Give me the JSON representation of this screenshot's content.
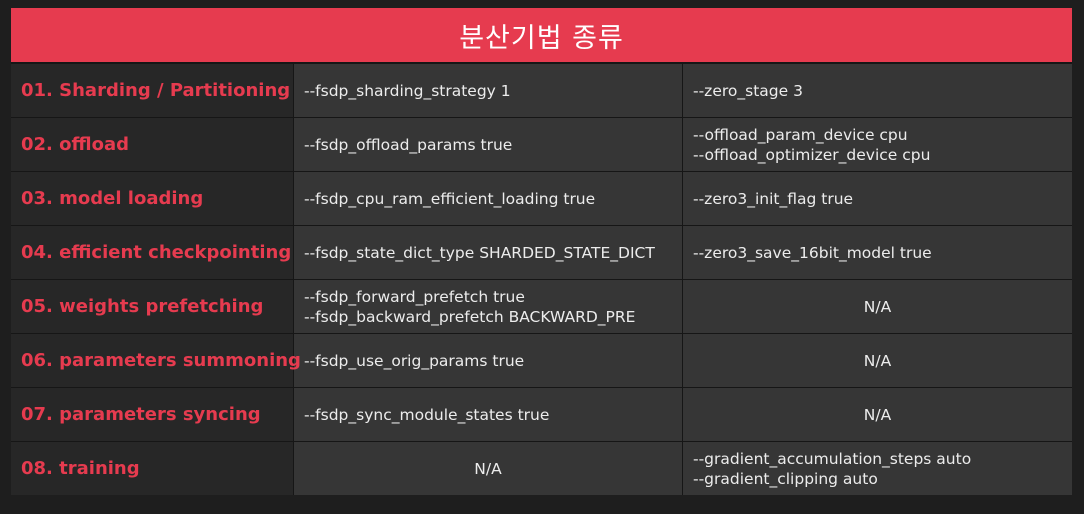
{
  "title": "분산기법 종류",
  "rows": [
    {
      "category": "01. Sharding / Partitioning",
      "fsdp": [
        "--fsdp_sharding_strategy 1"
      ],
      "deepspeed": [
        "--zero_stage 3"
      ]
    },
    {
      "category": "02. offload",
      "fsdp": [
        "--fsdp_offload_params true"
      ],
      "deepspeed": [
        "--offload_param_device cpu",
        "--offload_optimizer_device cpu"
      ]
    },
    {
      "category": "03. model loading",
      "fsdp": [
        "--fsdp_cpu_ram_efficient_loading true"
      ],
      "deepspeed": [
        "--zero3_init_flag true"
      ]
    },
    {
      "category": "04. efficient checkpointing",
      "fsdp": [
        "--fsdp_state_dict_type SHARDED_STATE_DICT"
      ],
      "deepspeed": [
        "--zero3_save_16bit_model true"
      ]
    },
    {
      "category": "05. weights prefetching",
      "fsdp": [
        "--fsdp_forward_prefetch true",
        "--fsdp_backward_prefetch BACKWARD_PRE"
      ],
      "deepspeed": [
        "N/A"
      ]
    },
    {
      "category": "06. parameters summoning",
      "fsdp": [
        "--fsdp_use_orig_params true"
      ],
      "deepspeed": [
        "N/A"
      ]
    },
    {
      "category": "07. parameters syncing",
      "fsdp": [
        "--fsdp_sync_module_states true"
      ],
      "deepspeed": [
        "N/A"
      ]
    },
    {
      "category": "08. training",
      "fsdp": [
        "N/A"
      ],
      "deepspeed": [
        "--gradient_accumulation_steps auto",
        "--gradient_clipping auto"
      ]
    }
  ],
  "colors": {
    "accent": "#e63b4f",
    "cell": "#363636",
    "category_cell": "#272727",
    "background": "#1e1e1e"
  }
}
